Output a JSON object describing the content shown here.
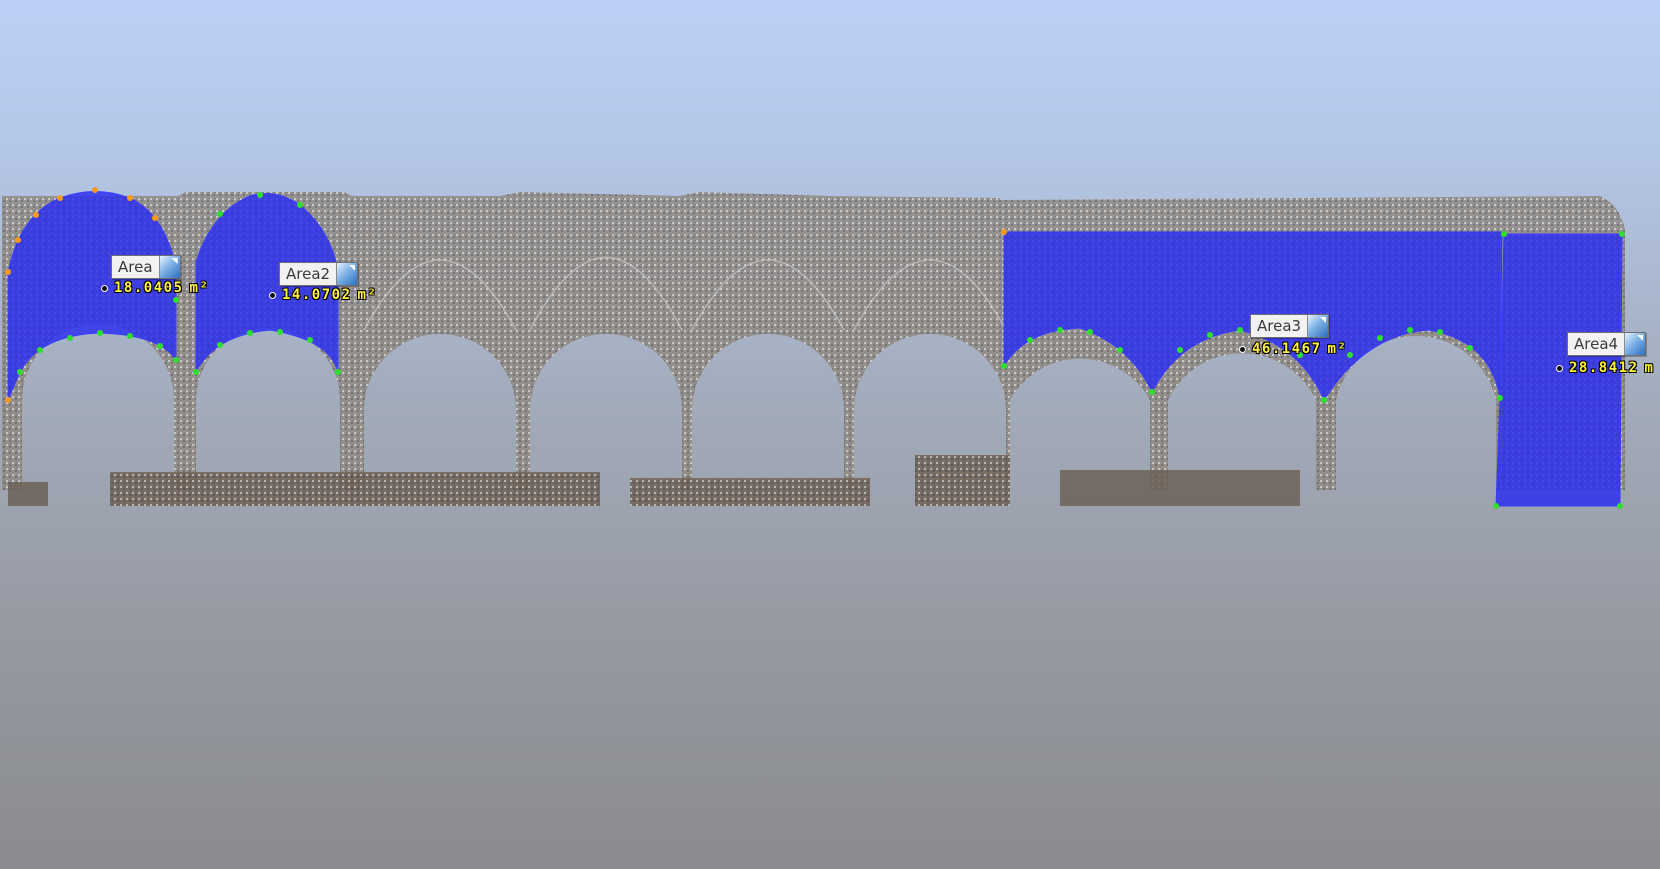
{
  "scene": {
    "background_top": "#bcd0f7",
    "background_bottom": "#8a8b8e",
    "fill_color": "#2a2cf0",
    "node_color": "#2ee02e",
    "node_color_alt": "#f59a1f",
    "point_cloud_tone": "#8f8a84"
  },
  "measurements": [
    {
      "label": "Area",
      "value": "18.0405",
      "unit": "m²"
    },
    {
      "label": "Area2",
      "value": "14.0702",
      "unit": "m²"
    },
    {
      "label": "Area3",
      "value": "46.1467",
      "unit": "m²"
    },
    {
      "label": "Area4",
      "value": "28.8412",
      "unit": "m"
    }
  ]
}
